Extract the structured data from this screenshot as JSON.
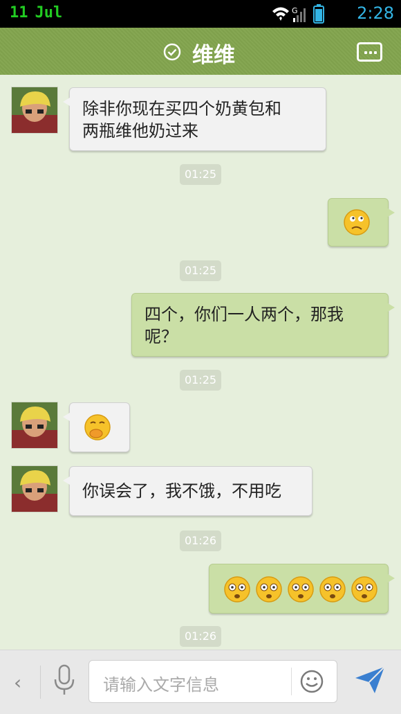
{
  "status_bar": {
    "date_day": "11",
    "date_month": "Jul",
    "time": "2:28"
  },
  "header": {
    "title": "维维",
    "more_icon": "more-icon",
    "verified_icon": "check-circle-icon"
  },
  "messages": [
    {
      "side": "in",
      "text_line1": "除非你现在买四个奶黄包和",
      "text_line2": "两瓶维他奶过来"
    },
    {
      "timestamp": "01:25"
    },
    {
      "side": "out",
      "emoji": "confused-face"
    },
    {
      "timestamp": "01:25"
    },
    {
      "side": "out",
      "text_line1": "四个，你们一人两个，那我",
      "text_line2": "呢？"
    },
    {
      "timestamp": "01:25"
    },
    {
      "side": "in",
      "emoji": "giggle-face"
    },
    {
      "side": "in",
      "text": "你误会了，我不饿，不用吃"
    },
    {
      "timestamp": "01:26"
    },
    {
      "side": "out",
      "emoji": "shocked-face",
      "count": 5
    },
    {
      "timestamp": "01:26"
    }
  ],
  "input_bar": {
    "placeholder": "请输入文字信息"
  },
  "colors": {
    "header_green": "#7fa04c",
    "outgoing_bubble": "#cadfa6",
    "chat_bg": "#e6efdc",
    "send_blue": "#3a7fd0"
  }
}
